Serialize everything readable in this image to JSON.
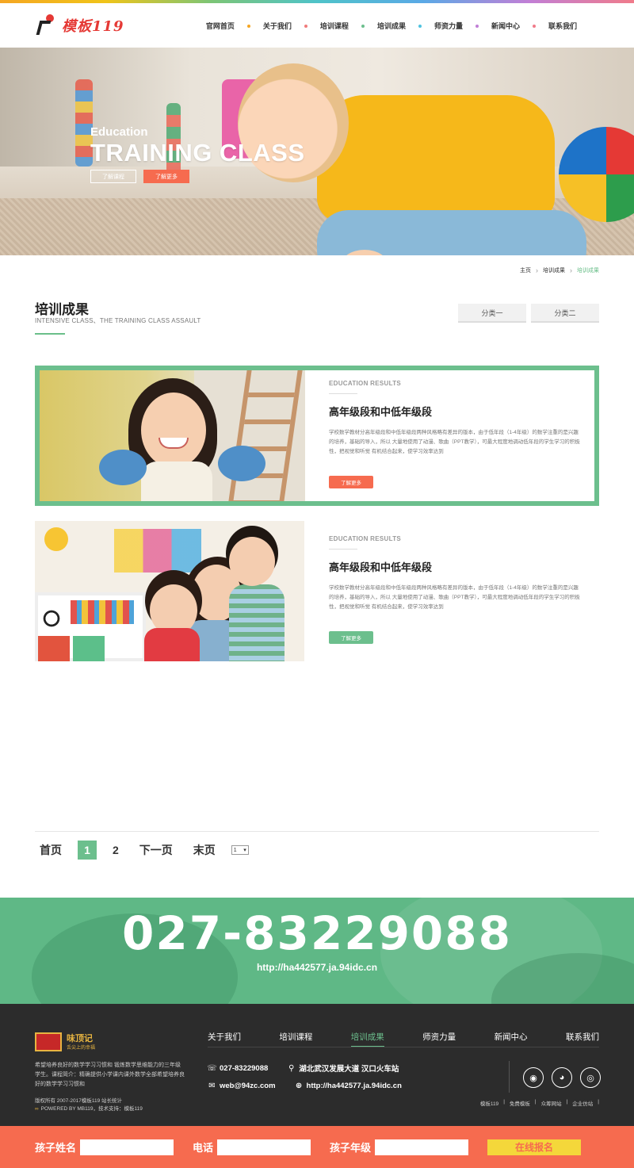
{
  "header": {
    "logo_text": "模板119",
    "nav": [
      {
        "label": "官网首页",
        "dot": "#f5a623"
      },
      {
        "label": "关于我们",
        "dot": "#f07b7b"
      },
      {
        "label": "培训课程",
        "dot": "#6cbf8d"
      },
      {
        "label": "培训成果",
        "dot": "#4fc3e0"
      },
      {
        "label": "师资力量",
        "dot": "#c17fd6"
      },
      {
        "label": "新闻中心",
        "dot": "#f07b8a"
      },
      {
        "label": "联系我们",
        "dot": ""
      }
    ]
  },
  "banner": {
    "subtitle": "Education",
    "title": "TRAINING CLASS",
    "btn_course": "了解课程",
    "btn_more": "了解更多"
  },
  "breadcrumb": {
    "home": "主页",
    "level1": "培训成果",
    "current": "培训成果"
  },
  "section": {
    "title": "培训成果",
    "subtitle": "INTENSIVE CLASS、THE TRAINING CLASS ASSAULT",
    "categories": [
      "分类一",
      "分类二"
    ]
  },
  "cards": [
    {
      "label": "EDUCATION RESULTS",
      "title": "高年级段和中低年级段",
      "desc": "学校数学教材分高年级段和中低年级段两种风格略有差异的版本，由于低年段（1-4年级）的数学注重的是兴趣的培养，基础的导入，所以 大量地使用了动漫、歌曲（PPT教学），可最大程度地调动低年段的学生学习的积极性，把视觉和听觉 有机结合起来，使学习效率达到",
      "more": "了解更多"
    },
    {
      "label": "EDUCATION RESULTS",
      "title": "高年级段和中低年级段",
      "desc": "学校数学教材分高年级段和中低年级段两种风格略有差异的版本，由于低年段（1-4年级）的数学注重的是兴趣的培养，基础的导入，所以 大量地使用了动漫、歌曲（PPT教学），可最大程度地调动低年段的学生学习的积极性，把视觉和听觉 有机结合起来，使学习效率达到",
      "more": "了解更多"
    }
  ],
  "pagination": {
    "first": "首页",
    "pages": [
      "1",
      "2"
    ],
    "current": "1",
    "next": "下一页",
    "last": "末页",
    "select_value": "1"
  },
  "contact_band": {
    "phone": "027-83229088",
    "url": "http://ha442577.ja.94idc.cn"
  },
  "footer": {
    "brand_name": "味顶记",
    "brand_slogan": "舌尖上的幸福",
    "desc": "希望培养良好的数学学习习惯和 锻炼数学思维能力的三年级学生。课程简介：精确提供小学课内课外数学全部希望培养良好的数学学习习惯和",
    "copyright": "版权所有 2007-2017模板119 站长统计",
    "powered": "POWERED BY MB119，技术支持：模板119",
    "nav": [
      "关于我们",
      "培训课程",
      "培训成果",
      "师资力量",
      "新闻中心",
      "联系我们"
    ],
    "nav_active": "培训成果",
    "phone": "027-83229088",
    "address": "湖北武汉发展大道 汉口火车站",
    "email": "web@94zc.com",
    "website": "http://ha442577.ja.94idc.cn",
    "links": [
      "模板119",
      "|",
      "免费模板",
      "|",
      "众筹网站",
      "|",
      "企业仿站",
      "|"
    ],
    "social_icons": [
      "qq-icon",
      "wechat-icon",
      "weibo-icon"
    ]
  },
  "signup": {
    "child_name_label": "孩子姓名",
    "phone_label": "电话",
    "grade_label": "孩子年级",
    "submit": "在线报名"
  },
  "colors": {
    "accent_green": "#6cbf8d",
    "accent_orange": "#f66b4f",
    "footer_bg": "#2c2c2c",
    "submit_yellow": "#f4d73a"
  }
}
